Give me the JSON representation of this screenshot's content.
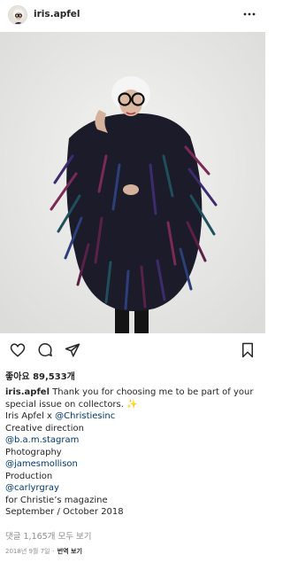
{
  "header": {
    "username": "iris.apfel",
    "avatar_icon": "profile-photo",
    "more_icon": "ellipsis-icon"
  },
  "photo": {
    "background_color": "#ededec",
    "coat_colors": [
      "#1b1b2a",
      "#3e2b6e",
      "#7a2a55",
      "#1f4f5c",
      "#2c3f7a",
      "#5a2048"
    ]
  },
  "actions": {
    "like_icon": "heart-outline-icon",
    "comment_icon": "comment-bubble-icon",
    "share_icon": "paper-plane-icon",
    "bookmark_icon": "bookmark-outline-icon"
  },
  "likes": {
    "text": "좋아요 89,533개"
  },
  "caption": {
    "username": "iris.apfel",
    "intro": "Thank you for choosing me to be part of your special issue on collectors.",
    "sparkle": "✨",
    "line_credit_prefix": "Iris Apfel x ",
    "line_credit_mention": "@Christiesinc",
    "creative_direction_label": "Creative direction",
    "creative_direction_mention": "@b.a.m.stagram",
    "photography_label": "Photography",
    "photography_mention": "@jamesmollison",
    "production_label": "Production",
    "production_mention": "@carlyrgray",
    "magazine": "for Christie’s magazine",
    "issue": "September / October  2018"
  },
  "comments": {
    "view_all": "댓글 1,165개 모두 보기"
  },
  "timestamp": {
    "date": "2018년 9월 7일",
    "separator": "·",
    "translate": "번역 보기"
  },
  "colors": {
    "text": "#262626",
    "link": "#00376b",
    "muted": "#8e8e8e"
  }
}
